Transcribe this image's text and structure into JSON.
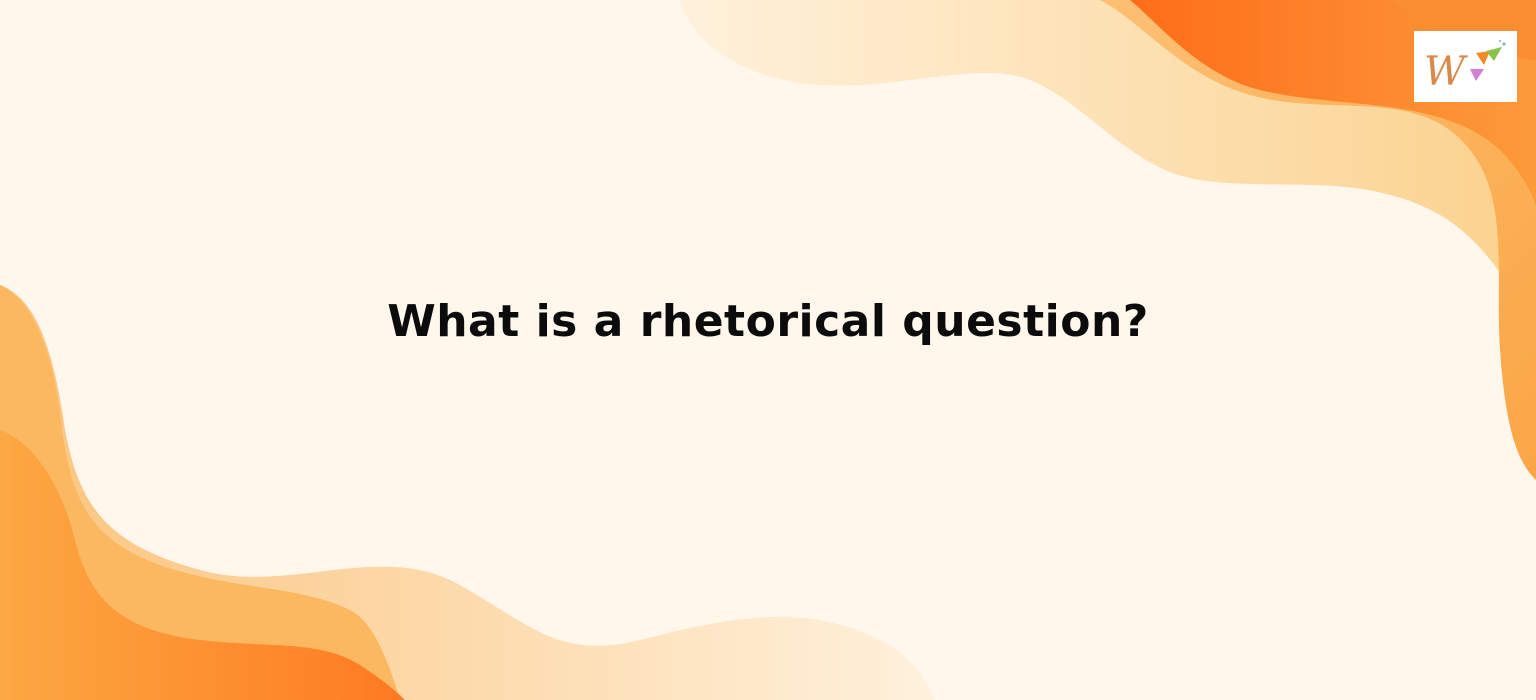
{
  "slide": {
    "headline": "What is a rhetorical question?"
  },
  "logo": {
    "letter": "W",
    "icon": "brand-logo-icon"
  },
  "colors": {
    "background": "#fff6ec",
    "wave_light": "#fcd9a4",
    "wave_mid": "#fbb454",
    "wave_dark": "#fe7a22",
    "text": "#0b0b0b",
    "logo_letter": "#d98a4a"
  }
}
